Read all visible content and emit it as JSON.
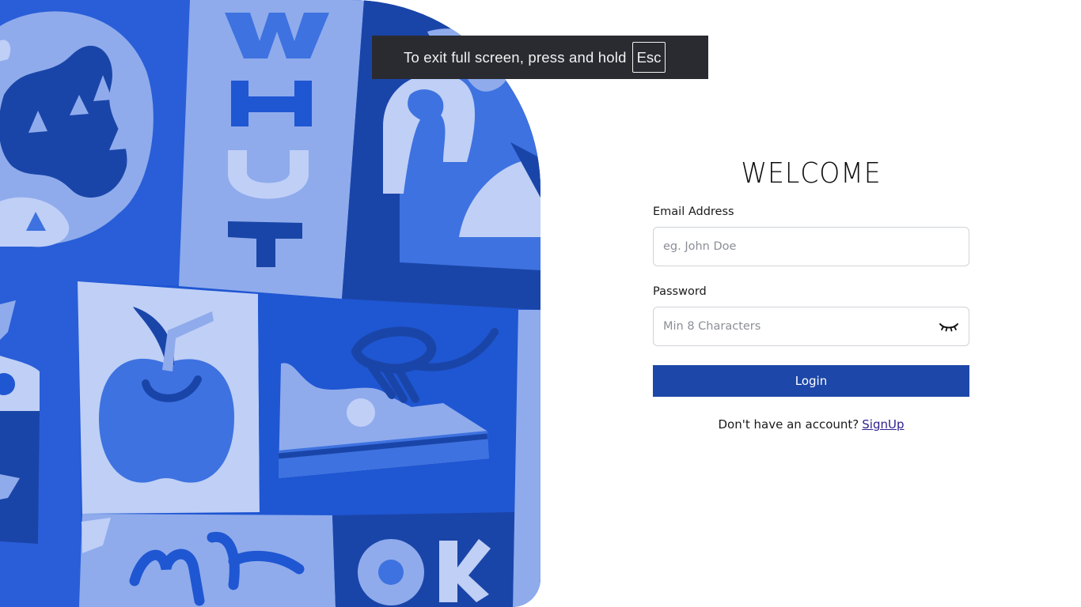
{
  "fullscreen_notice": {
    "text": "To exit full screen, press and hold",
    "key": "Esc"
  },
  "login": {
    "title": "WELCOME",
    "email": {
      "label": "Email Address",
      "placeholder": "eg. John Doe",
      "value": ""
    },
    "password": {
      "label": "Password",
      "placeholder": "Min 8 Characters",
      "value": "",
      "toggle_icon": "eye-closed-icon"
    },
    "submit_label": "Login",
    "signup_prompt": "Don't have an account?",
    "signup_link": "SignUp"
  },
  "illustration": {
    "letters": [
      "W",
      "H",
      "U",
      "T",
      "O",
      "K"
    ],
    "motifs": [
      "globe",
      "apple",
      "sneaker",
      "hand-lettering"
    ]
  },
  "colors": {
    "primary_button": "#1d47a8",
    "link": "#2b1f8f",
    "art_dark": "#1a45a8",
    "art_mid": "#3e72e0",
    "art_light": "#8fabec",
    "art_pale": "#bfcff6",
    "notice_bg": "#2a2b31"
  }
}
